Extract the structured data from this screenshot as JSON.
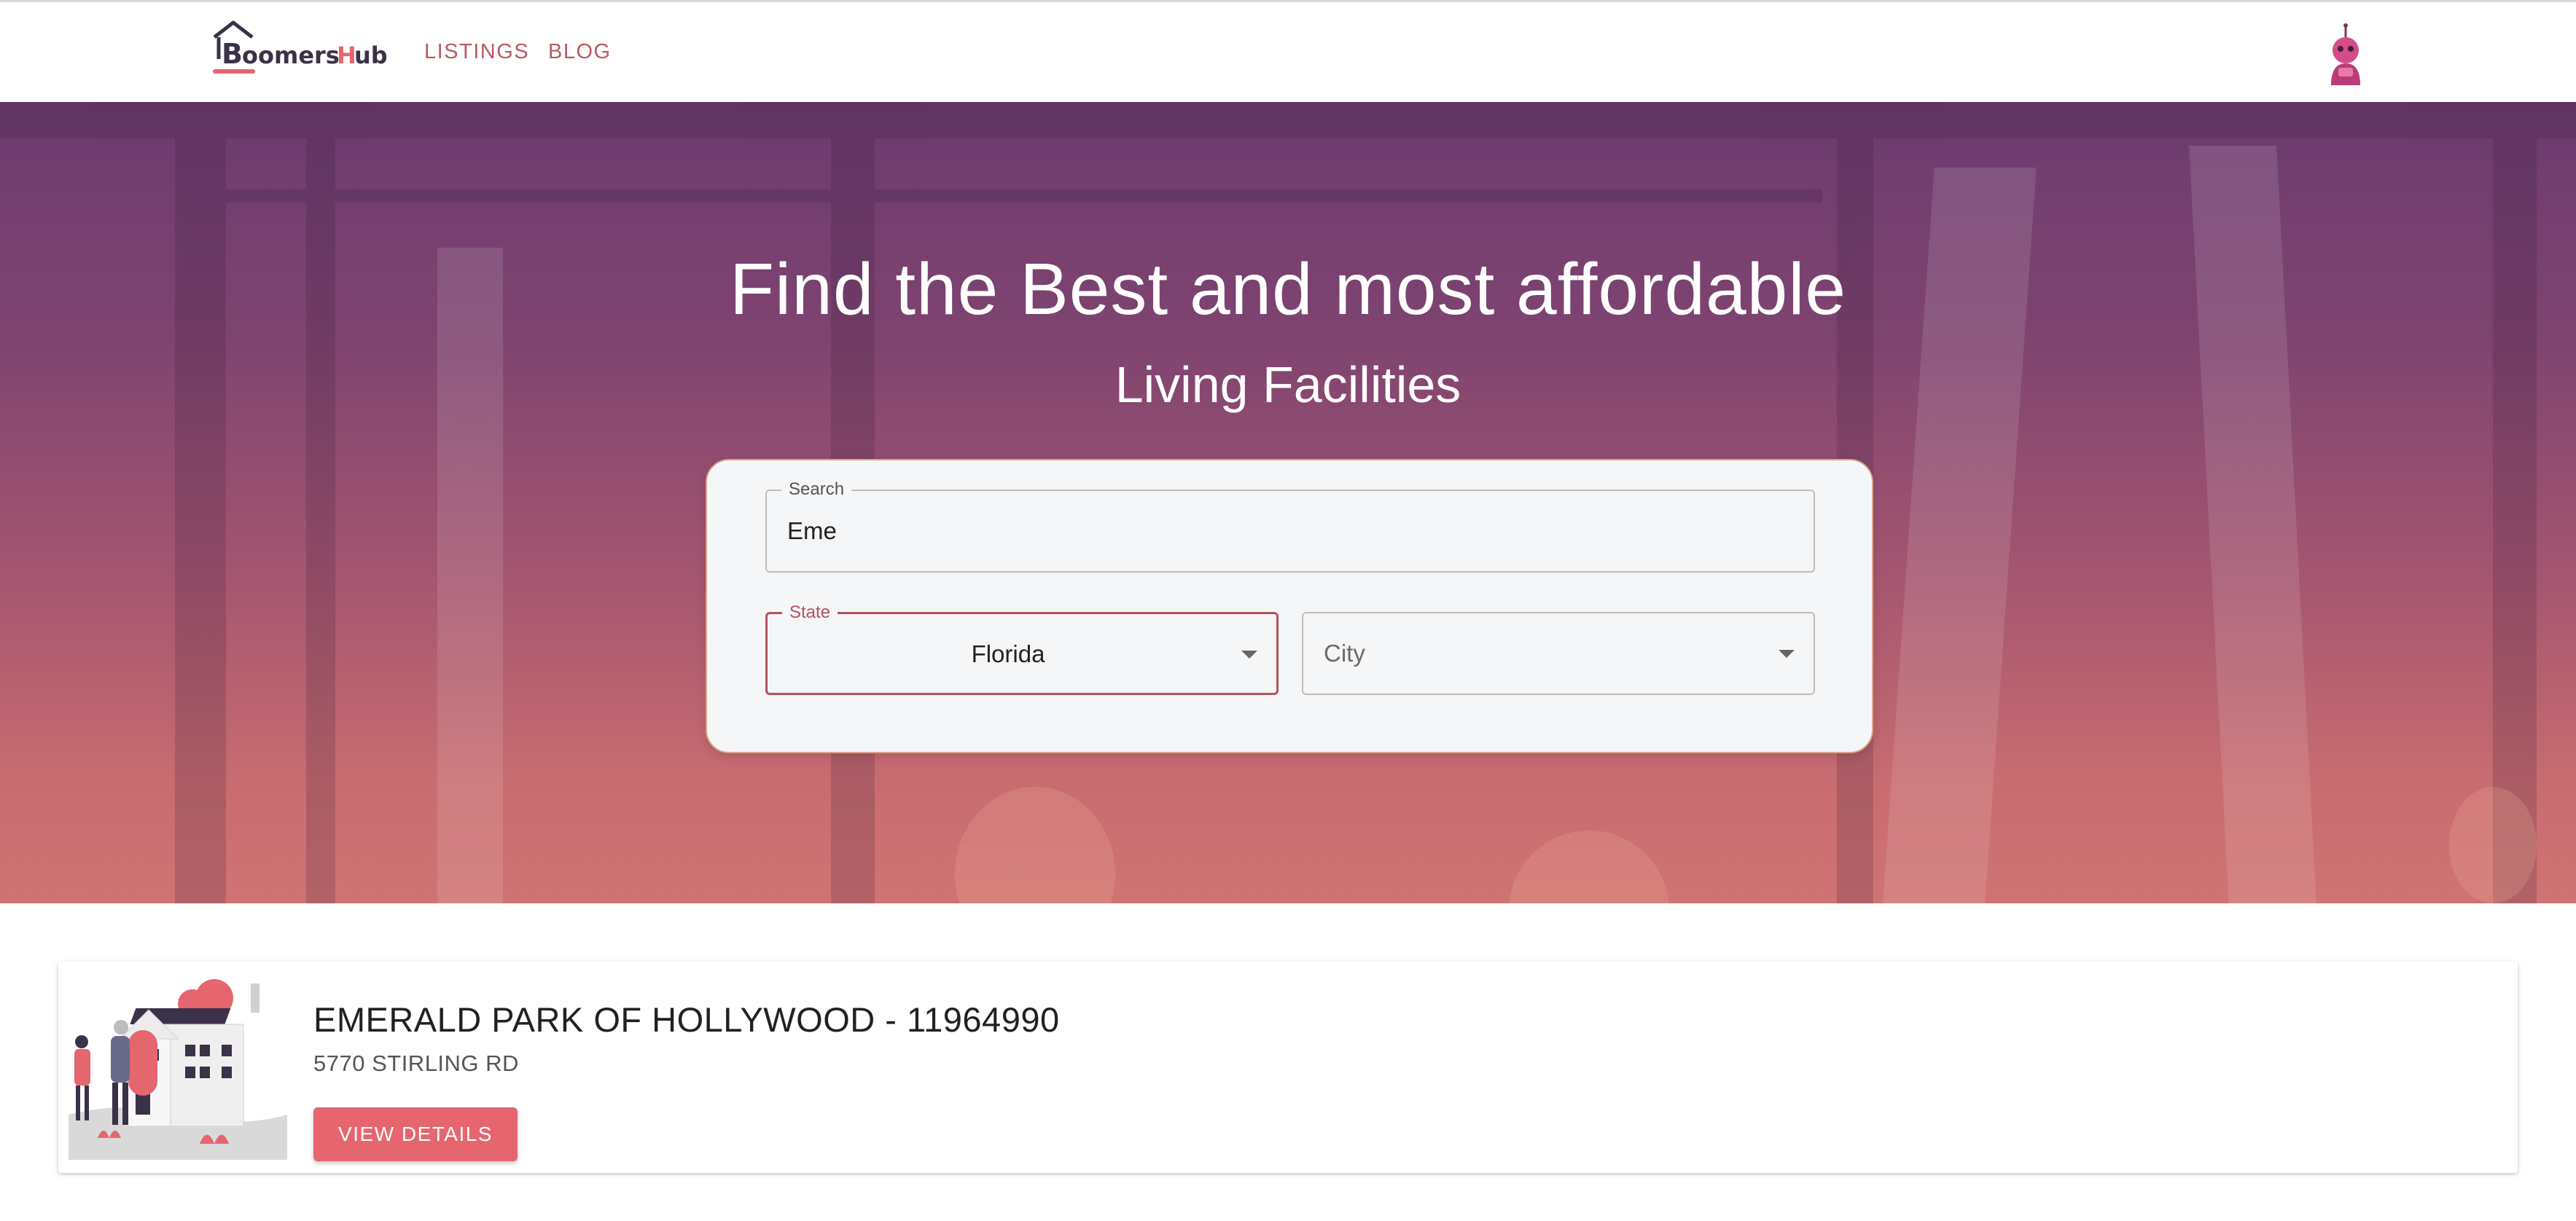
{
  "header": {
    "logo_text": "BoomersHub",
    "nav": [
      {
        "label": "LISTINGS"
      },
      {
        "label": "BLOG"
      }
    ],
    "avatar_icon": "robot-avatar-icon"
  },
  "hero": {
    "title": "Find the Best and most affordable",
    "subtitle": "Living Facilities"
  },
  "search": {
    "search_label": "Search",
    "search_value": "Eme",
    "state_label": "State",
    "state_value": "Florida",
    "city_placeholder": "City"
  },
  "listings": [
    {
      "title": "EMERALD PARK OF HOLLYWOOD - 11964990",
      "address": "5770 STIRLING RD",
      "button_label": "VIEW DETAILS",
      "image_icon": "house-couple-illustration"
    }
  ],
  "colors": {
    "accent": "#b5525c",
    "button": "#e5666e",
    "hero_top": "#6c3b70",
    "hero_bottom": "#d07373"
  }
}
